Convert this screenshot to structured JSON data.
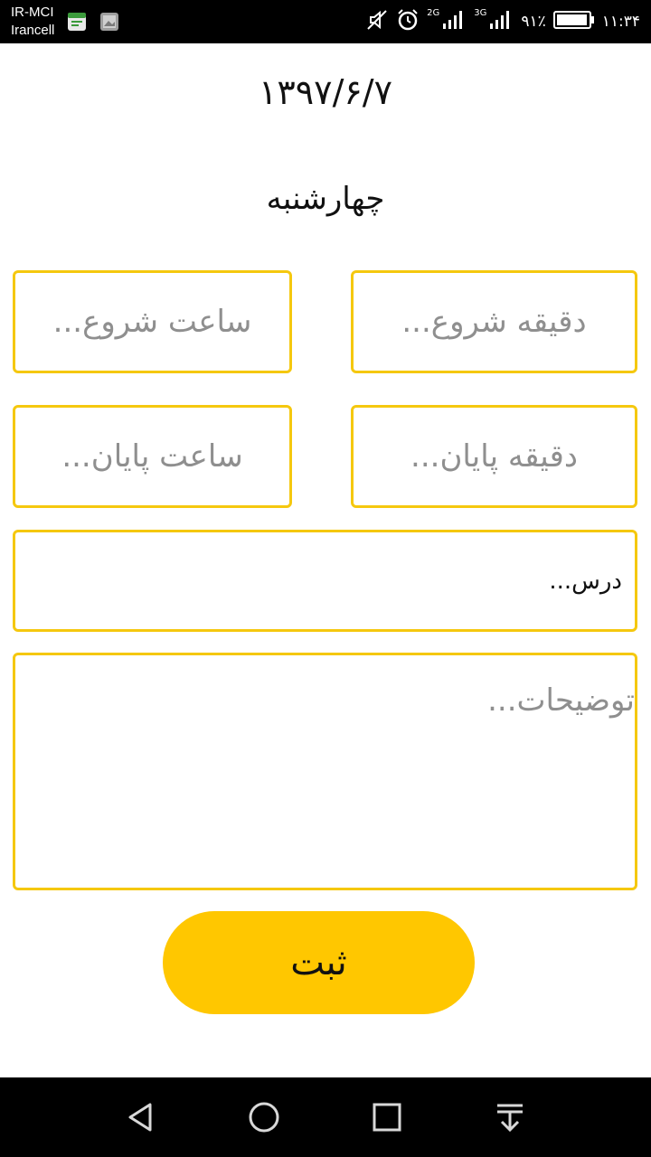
{
  "status_bar": {
    "carrier_line1": "IR-MCI",
    "carrier_line2": "Irancell",
    "net_2g": "2G",
    "net_3g": "3G",
    "battery_percent": "۹۱٪",
    "time": "۱۱:۳۴",
    "icons": [
      "calendar-app-icon",
      "image-notification-icon",
      "mute-icon",
      "alarm-icon",
      "signal-2g-icon",
      "signal-3g-icon",
      "battery-icon"
    ]
  },
  "header": {
    "date": "۱۳۹۷/۶/۷",
    "weekday": "چهارشنبه"
  },
  "form": {
    "start_hour_placeholder": "ساعت شروع...",
    "start_minute_placeholder": "دقیقه شروع...",
    "end_hour_placeholder": "ساعت پایان...",
    "end_minute_placeholder": "دقیقه پایان...",
    "lesson_value": "درس...",
    "description_placeholder": "توضیحات...",
    "submit_label": "ثبت",
    "accent_border": "#f5c80f",
    "button_color": "#ffc700"
  },
  "nav_bar": {
    "icons": [
      "back-icon",
      "home-icon",
      "recents-icon",
      "notification-pull-icon"
    ]
  }
}
